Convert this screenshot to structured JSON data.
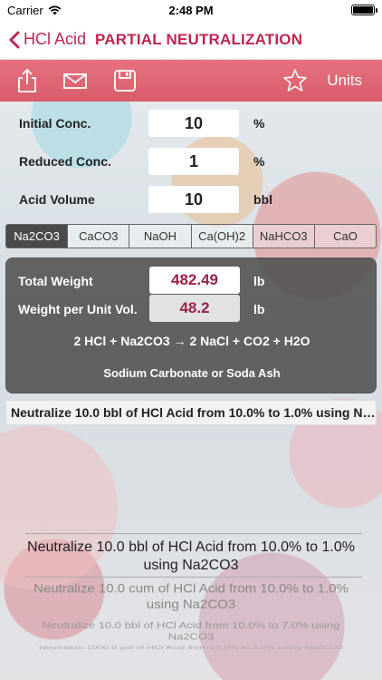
{
  "status": {
    "carrier": "Carrier",
    "time": "2:48 PM"
  },
  "nav": {
    "back_label": "HCl Acid",
    "title": "PARTIAL NEUTRALIZATION"
  },
  "toolbar": {
    "units_label": "Units"
  },
  "inputs": [
    {
      "label": "Initial Conc.",
      "value": "10",
      "unit": "%"
    },
    {
      "label": "Reduced Conc.",
      "value": "1",
      "unit": "%"
    },
    {
      "label": "Acid Volume",
      "value": "10",
      "unit": "bbl"
    }
  ],
  "segments": [
    "Na2CO3",
    "CaCO3",
    "NaOH",
    "Ca(OH)2",
    "NaHCO3",
    "CaO"
  ],
  "selected_segment": "Na2CO3",
  "results": {
    "total_weight": {
      "label": "Total Weight",
      "value": "482.49",
      "unit": "lb"
    },
    "weight_per_unit": {
      "label": "Weight per Unit Vol.",
      "value": "48.2",
      "unit": "lb"
    },
    "equation": "2 HCl + Na2CO3 → 2 NaCl + CO2 + H2O",
    "compound_name": "Sodium Carbonate or Soda Ash"
  },
  "summary": "Neutralize 10.0 bbl of HCl Acid from 10.0% to 1.0% using Na2CO3",
  "picker_items": [
    "Neutralize 10.0 bbl of HCl Acid from 10.0% to 1.0% using Na2CO3",
    "Neutralize 10.0 cum of HCl Acid from 10.0% to 1.0% using Na2CO3",
    "Neutralize 10.0 bbl of HCl Acid from 10.0% to 7.0% using Na2CO3",
    "Neutralize 1000.0 gal of HCl Acid from 15.0% to 5.0% using Na2CO3"
  ],
  "colors": {
    "accent": "#c0264f",
    "toolbar": "#e0656f",
    "result_value": "#9b2344",
    "panel": "#505050"
  }
}
